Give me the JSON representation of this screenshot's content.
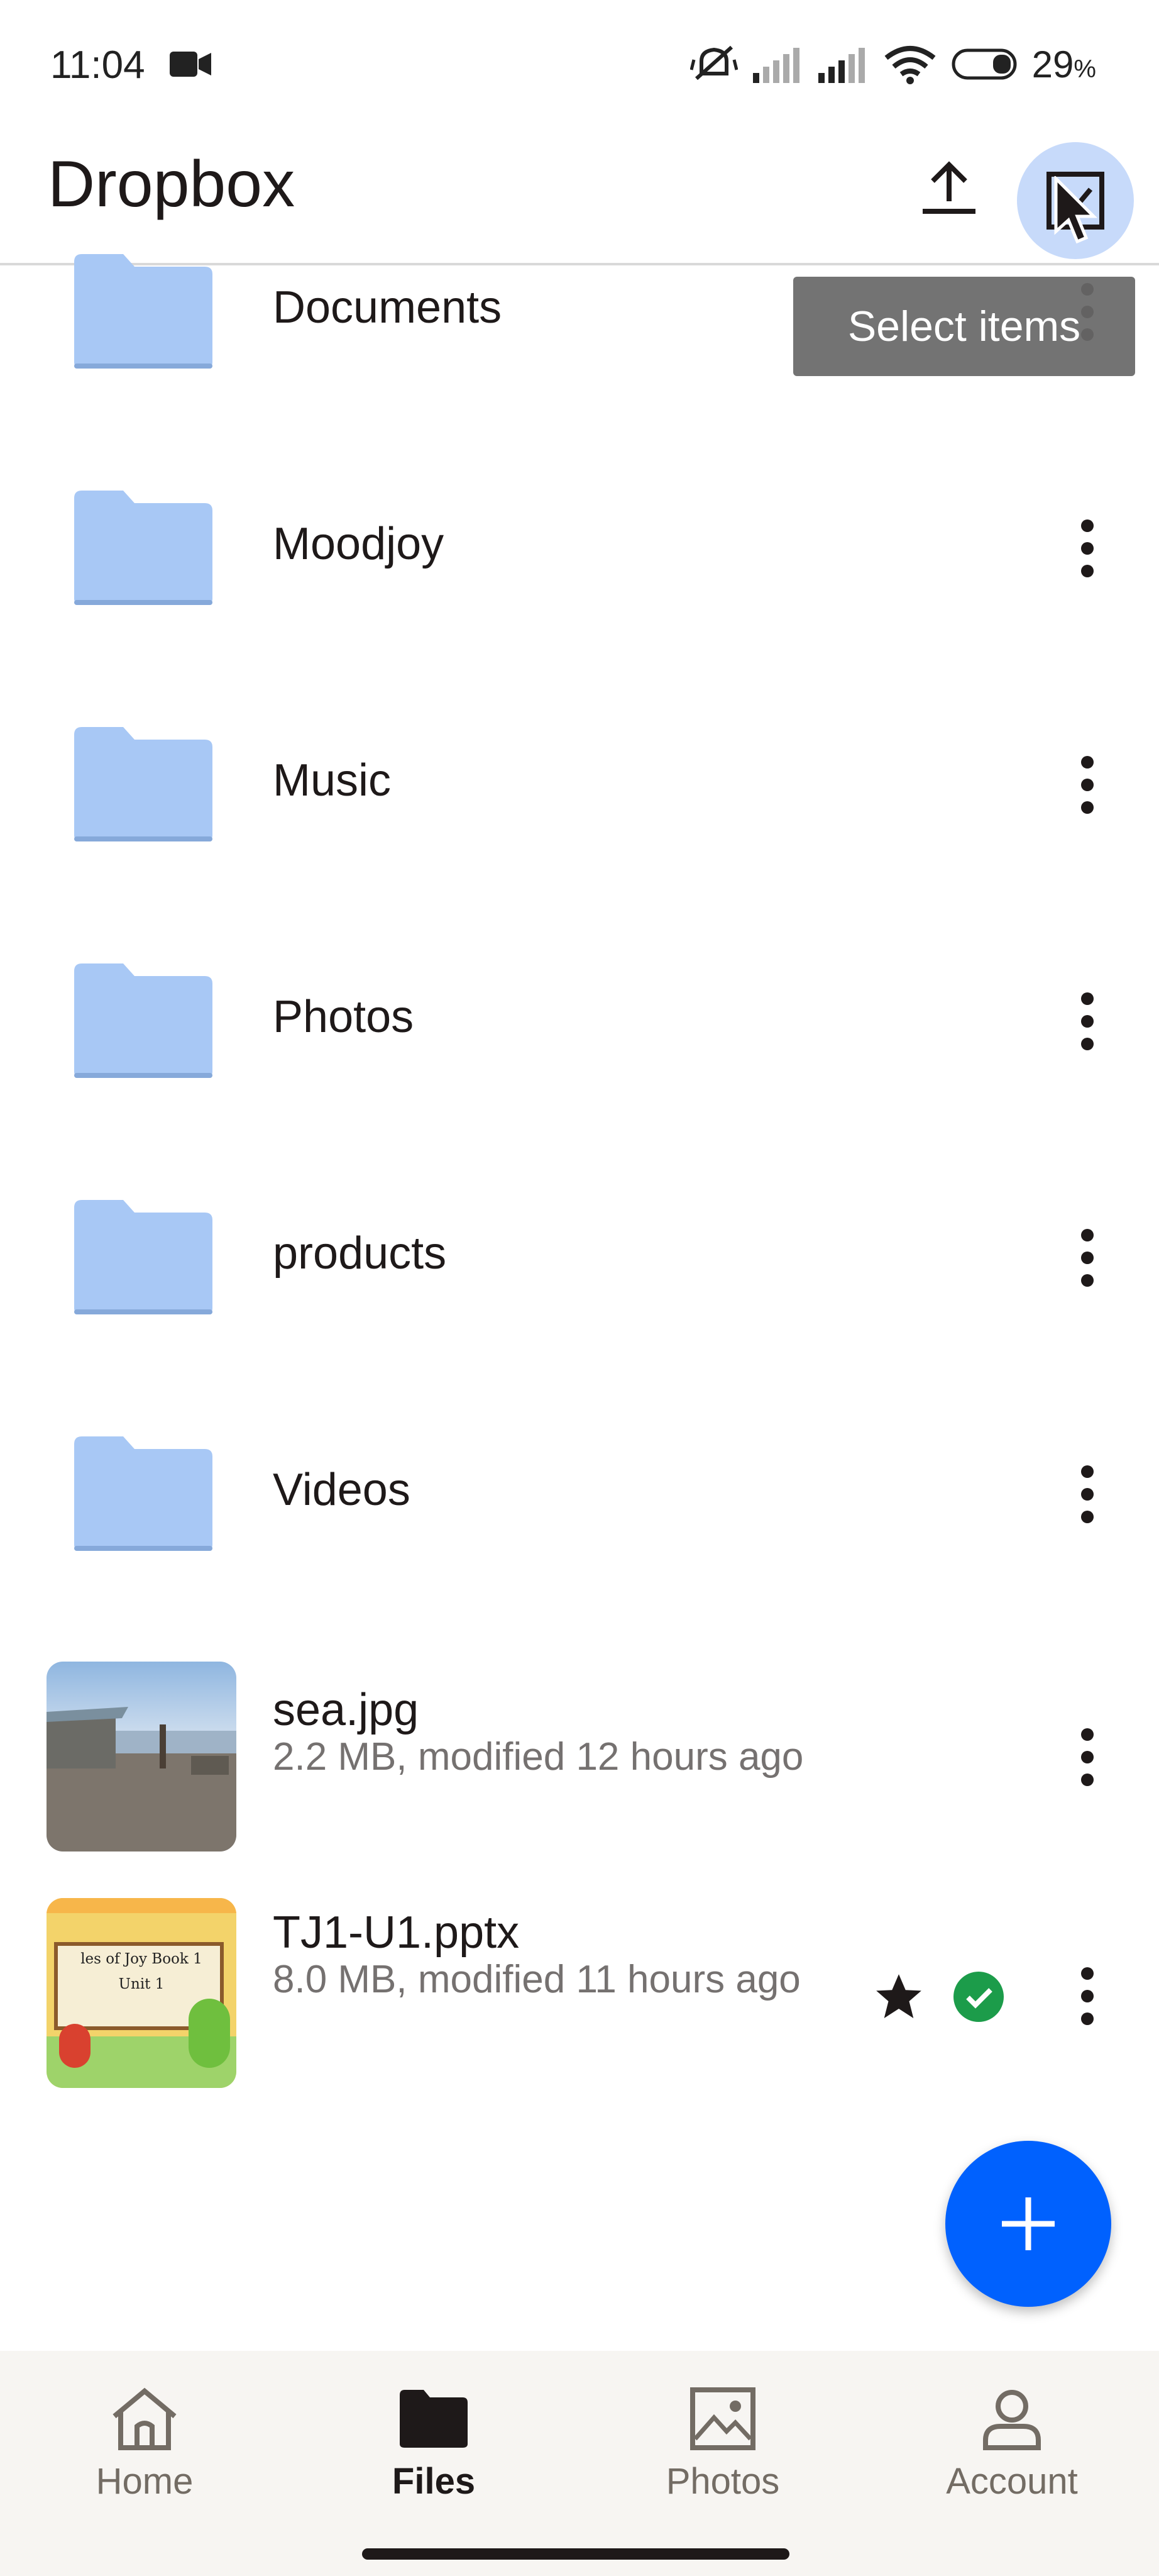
{
  "status_bar": {
    "time": "11:04",
    "battery": "29",
    "battery_unit": "%"
  },
  "app_bar": {
    "title": "Dropbox"
  },
  "tooltip": {
    "text": "Select items"
  },
  "files": [
    {
      "type": "folder",
      "name": "Documents"
    },
    {
      "type": "folder",
      "name": "Moodjoy"
    },
    {
      "type": "folder",
      "name": "Music"
    },
    {
      "type": "folder",
      "name": "Photos"
    },
    {
      "type": "folder",
      "name": "products"
    },
    {
      "type": "folder",
      "name": "Videos"
    },
    {
      "type": "file",
      "name": "sea.jpg",
      "meta": "2.2 MB, modified 12 hours ago"
    },
    {
      "type": "file",
      "name": "TJ1-U1.pptx",
      "meta": "8.0 MB, modified 11 hours ago",
      "starred": true,
      "synced": true,
      "thumb_text_1": "les of Joy Book 1",
      "thumb_text_2": "Unit 1"
    }
  ],
  "bottom_nav": [
    {
      "label": "Home",
      "icon": "home-icon"
    },
    {
      "label": "Files",
      "icon": "folder-icon",
      "active": true
    },
    {
      "label": "Photos",
      "icon": "image-icon"
    },
    {
      "label": "Account",
      "icon": "person-icon"
    }
  ],
  "colors": {
    "accent": "#0061fe",
    "folder": "#a8c8f5",
    "synced": "#1c9c4a"
  }
}
